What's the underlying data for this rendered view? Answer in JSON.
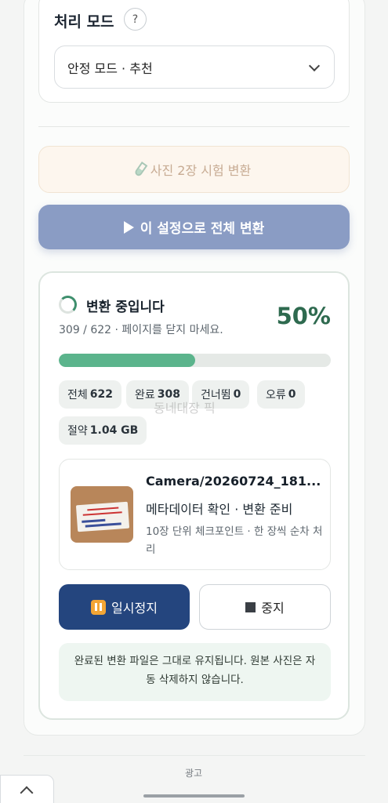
{
  "mode": {
    "title": "처리 모드",
    "help_label": "?",
    "selected": "안정 모드 · 추천"
  },
  "actions": {
    "test_label": "사진 2장 시험 변환",
    "convert_label": "이 설정으로 전체 변환"
  },
  "progress": {
    "title": "변환 중입니다",
    "subtitle": "309 / 622 · 페이지를 닫지 마세요.",
    "percent_label": "50%",
    "percent": 50,
    "stats": [
      {
        "label": "전체",
        "value": "622"
      },
      {
        "label": "완료",
        "value": "308"
      },
      {
        "label": "건너뜀",
        "value": "0"
      },
      {
        "label": "오류",
        "value": "0"
      }
    ],
    "savings": {
      "label": "절약",
      "value": "1.04 GB"
    },
    "watermark": "동네대장 픽"
  },
  "current_file": {
    "name": "Camera/20260724_181...",
    "step": "메타데이터 확인 · 변환 준비",
    "note": "10장 단위 체크포인트 · 한 장씩 순차 처리"
  },
  "controls": {
    "pause_label": "일시정지",
    "stop_label": "중지"
  },
  "info": "완료된 변환 파일은 그대로 유지됩니다. 원본 사진은 자동 삭제하지 않습니다.",
  "footer": {
    "ad_label": "광고"
  },
  "colors": {
    "accent": "#24457e",
    "progress": "#5bb48c",
    "percent_text": "#2e6a4f"
  }
}
